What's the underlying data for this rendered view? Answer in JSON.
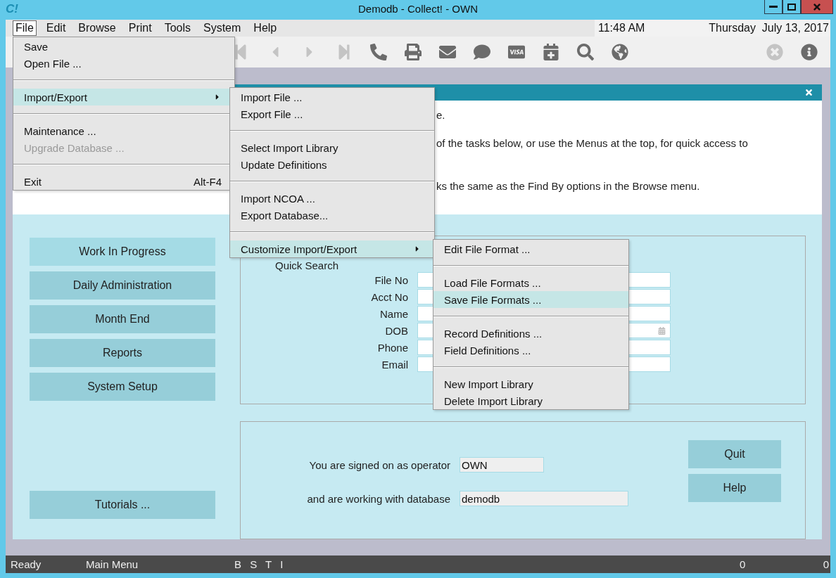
{
  "window": {
    "logo": "C!",
    "title": "Demodb - Collect! - OWN"
  },
  "menubar": {
    "items": [
      {
        "label": "File",
        "selected": true
      },
      {
        "label": "Edit",
        "selected": false
      },
      {
        "label": "Browse",
        "selected": false
      },
      {
        "label": "Print",
        "selected": false
      },
      {
        "label": "Tools",
        "selected": false
      },
      {
        "label": "System",
        "selected": false
      },
      {
        "label": "Help",
        "selected": false
      }
    ],
    "time": "11:48 AM",
    "date": "Thursday  July 13, 2017"
  },
  "toolbar": [
    {
      "kind": "first",
      "disabled": true
    },
    {
      "kind": "previous",
      "disabled": true
    },
    {
      "kind": "next",
      "disabled": true
    },
    {
      "kind": "last",
      "disabled": true
    },
    {
      "kind": "phone",
      "disabled": false
    },
    {
      "kind": "print",
      "disabled": false
    },
    {
      "kind": "mail",
      "disabled": false
    },
    {
      "kind": "chat",
      "disabled": false
    },
    {
      "kind": "payment",
      "disabled": false
    },
    {
      "kind": "schedule",
      "disabled": false
    },
    {
      "kind": "search",
      "disabled": false
    },
    {
      "kind": "globe",
      "disabled": false
    }
  ],
  "toolbar_right": [
    {
      "kind": "cancel",
      "disabled": true
    },
    {
      "kind": "info",
      "disabled": false
    }
  ],
  "panel": {
    "intro_lines": [
      "e.",
      "of the tasks below, or use the Menus at the top, for quick access to",
      "ks the same as the Find By options in the Browse menu."
    ]
  },
  "nav_buttons": [
    {
      "label": "Work In Progress",
      "selected": true
    },
    {
      "label": "Daily Administration",
      "selected": false
    },
    {
      "label": "Month End",
      "selected": false
    },
    {
      "label": "Reports",
      "selected": false
    },
    {
      "label": "System Setup",
      "selected": false
    }
  ],
  "tutorials_button": "Tutorials ...",
  "quick_search": {
    "title": "Quick Search",
    "fields": [
      {
        "label": "File No",
        "kind": "text"
      },
      {
        "label": "Acct No",
        "kind": "text"
      },
      {
        "label": "Name",
        "kind": "text"
      },
      {
        "label": "DOB",
        "kind": "date"
      },
      {
        "label": "Phone",
        "kind": "text"
      },
      {
        "label": "Email",
        "kind": "text"
      }
    ]
  },
  "session": {
    "rows": [
      {
        "label": "You are signed on as operator",
        "value": "OWN"
      },
      {
        "label": "and are working with database",
        "value": "demodb"
      }
    ],
    "buttons": [
      "Quit",
      "Help"
    ]
  },
  "file_menu": [
    {
      "kind": "item",
      "label": "Save",
      "selected": false,
      "disabled": false
    },
    {
      "kind": "item",
      "label": "Open File ...",
      "selected": false,
      "disabled": false
    },
    {
      "kind": "separator"
    },
    {
      "kind": "item",
      "label": "Import/Export",
      "selected": true,
      "disabled": false,
      "submenu": true
    },
    {
      "kind": "separator"
    },
    {
      "kind": "item",
      "label": "Maintenance ...",
      "selected": false,
      "disabled": false
    },
    {
      "kind": "item",
      "label": "Upgrade Database ...",
      "selected": false,
      "disabled": true
    },
    {
      "kind": "separator"
    },
    {
      "kind": "item",
      "label": "Exit",
      "selected": false,
      "disabled": false,
      "shortcut": "Alt-F4"
    }
  ],
  "import_export_menu": [
    {
      "kind": "item",
      "label": "Import File ...",
      "selected": false,
      "disabled": false
    },
    {
      "kind": "item",
      "label": "Export File ...",
      "selected": false,
      "disabled": false
    },
    {
      "kind": "separator"
    },
    {
      "kind": "item",
      "label": "Select Import Library",
      "selected": false,
      "disabled": false
    },
    {
      "kind": "item",
      "label": "Update Definitions",
      "selected": false,
      "disabled": false
    },
    {
      "kind": "separator"
    },
    {
      "kind": "item",
      "label": "Import NCOA ...",
      "selected": false,
      "disabled": false
    },
    {
      "kind": "item",
      "label": "Export Database...",
      "selected": false,
      "disabled": false
    },
    {
      "kind": "separator"
    },
    {
      "kind": "item",
      "label": "Customize Import/Export",
      "selected": true,
      "disabled": false,
      "submenu": true
    }
  ],
  "customize_menu": [
    {
      "kind": "item",
      "label": "Edit File Format ...",
      "selected": false,
      "disabled": false
    },
    {
      "kind": "separator"
    },
    {
      "kind": "item",
      "label": "Load File Formats ...",
      "selected": false,
      "disabled": false
    },
    {
      "kind": "item",
      "label": "Save File Formats ...",
      "selected": true,
      "disabled": false
    },
    {
      "kind": "separator"
    },
    {
      "kind": "item",
      "label": "Record Definitions ...",
      "selected": false,
      "disabled": false
    },
    {
      "kind": "item",
      "label": "Field Definitions ...",
      "selected": false,
      "disabled": false
    },
    {
      "kind": "separator"
    },
    {
      "kind": "item",
      "label": "New Import Library",
      "selected": false,
      "disabled": false
    },
    {
      "kind": "item",
      "label": "Delete Import Library",
      "selected": false,
      "disabled": false
    }
  ],
  "status_bar": {
    "state": "Ready",
    "screen": "Main Menu",
    "flags": "B S T I",
    "count_1": "0",
    "count_2": "0"
  }
}
